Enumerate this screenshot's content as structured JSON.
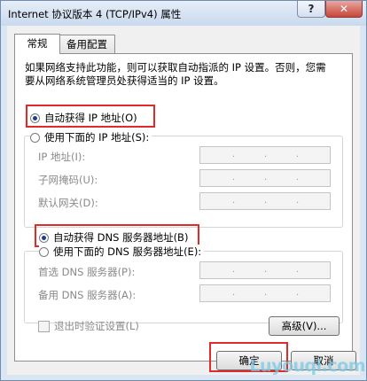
{
  "window": {
    "title": "Internet 协议版本 4 (TCP/IPv4) 属性",
    "help_label": "?",
    "close_label": "✕"
  },
  "tabs": [
    {
      "label": "常规",
      "active": true
    },
    {
      "label": "备用配置",
      "active": false
    }
  ],
  "description": "如果网络支持此功能，则可以获取自动指派的 IP 设置。否则，您需要从网络系统管理员处获得适当的 IP 设置。",
  "ip_section": {
    "auto_label": "自动获得 IP 地址(O)",
    "auto_selected": true,
    "manual_label": "使用下面的 IP 地址(S):",
    "fields": [
      {
        "label": "IP 地址(I):"
      },
      {
        "label": "子网掩码(U):"
      },
      {
        "label": "默认网关(D):"
      }
    ]
  },
  "dns_section": {
    "auto_label": "自动获得 DNS 服务器地址(B)",
    "auto_selected": true,
    "manual_label": "使用下面的 DNS 服务器地址(E):",
    "fields": [
      {
        "label": "首选 DNS 服务器(P):"
      },
      {
        "label": "备用 DNS 服务器(A):"
      }
    ]
  },
  "validate_checkbox": {
    "label": "退出时验证设置(L)",
    "checked": false
  },
  "buttons": {
    "advanced": "高级(V)...",
    "ok": "确定",
    "cancel": "取消"
  },
  "ip_dots": ".",
  "watermark": "Luyouqi.com",
  "highlight_color": "#e02b2b"
}
